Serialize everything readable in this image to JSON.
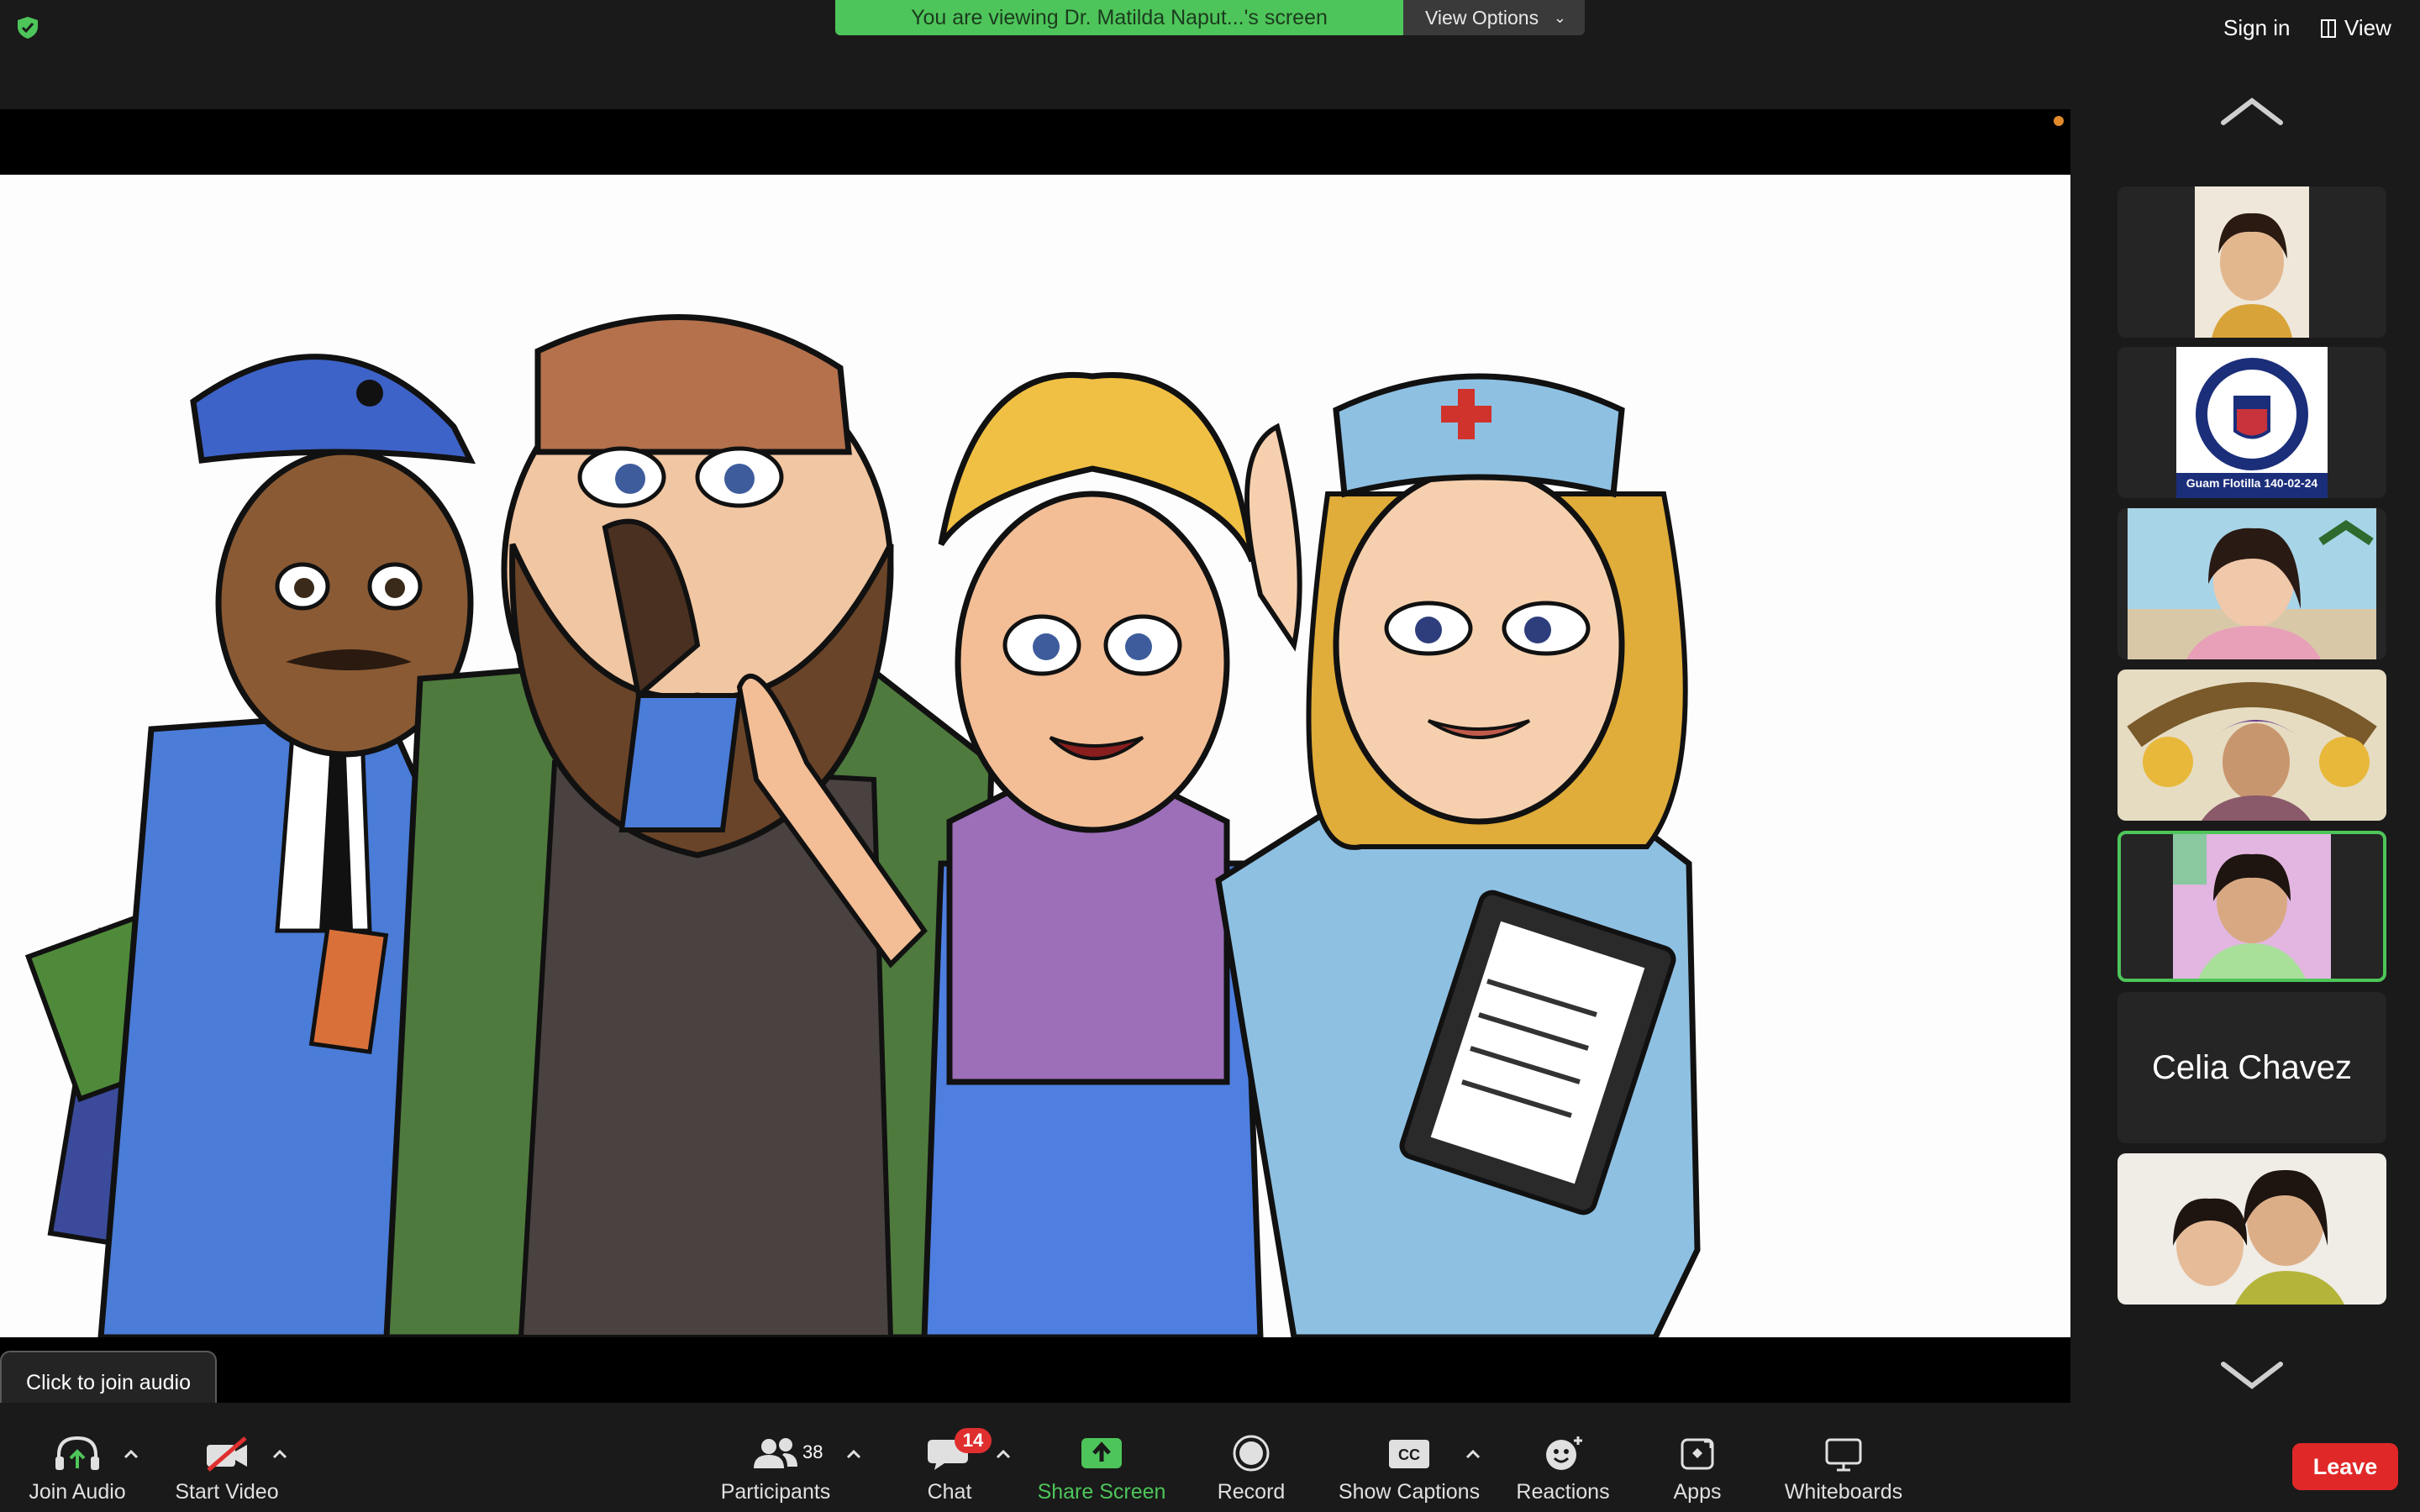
{
  "top_bar": {
    "banner_text": "You are viewing Dr. Matilda Naput...'s screen",
    "view_options_label": "View Options",
    "sign_in_label": "Sign in",
    "view_label": "View"
  },
  "gallery": {
    "participant_tiles": [
      {
        "kind": "video"
      },
      {
        "kind": "logo",
        "logo_text": "Guam Flotilla 140-02-24"
      },
      {
        "kind": "video"
      },
      {
        "kind": "video"
      },
      {
        "kind": "video",
        "active_speaker": true
      },
      {
        "kind": "name",
        "name": "Celia Chavez"
      },
      {
        "kind": "video"
      }
    ]
  },
  "tooltip": {
    "text": "Click to join audio"
  },
  "toolbar": {
    "join_audio_label": "Join Audio",
    "start_video_label": "Start Video",
    "participants_label": "Participants",
    "participants_count": "38",
    "chat_label": "Chat",
    "chat_badge": "14",
    "share_screen_label": "Share Screen",
    "record_label": "Record",
    "show_captions_label": "Show Captions",
    "captions_icon_text": "CC",
    "reactions_label": "Reactions",
    "apps_label": "Apps",
    "whiteboards_label": "Whiteboards",
    "leave_label": "Leave"
  },
  "colors": {
    "accent_green": "#4ec55a",
    "leave_red": "#e02828",
    "badge_red": "#e02f2f",
    "background": "#1a1a1a"
  }
}
